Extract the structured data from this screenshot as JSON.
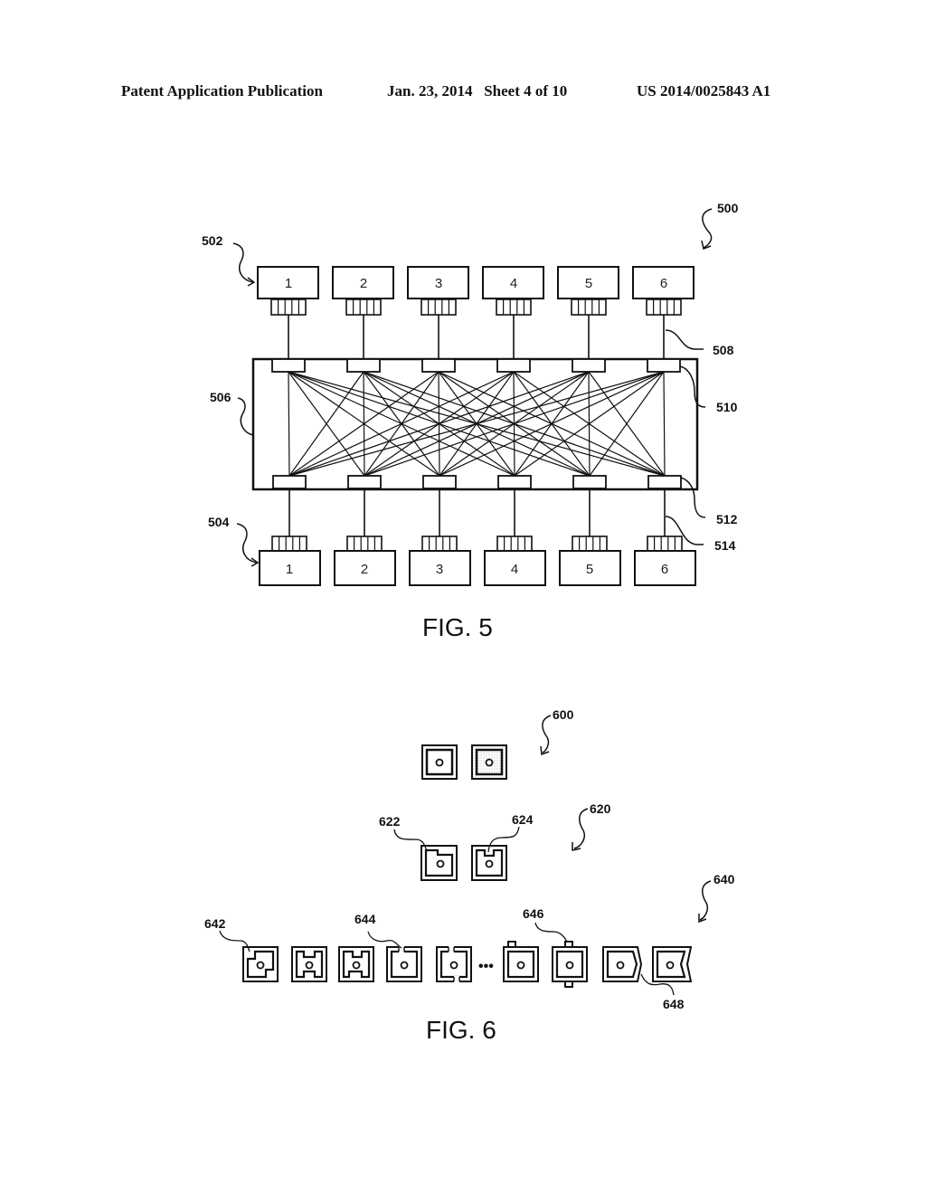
{
  "header": {
    "publication": "Patent Application Publication",
    "date_sheet": "Jan. 23, 2014   Sheet 4 of 10",
    "patent_number": "US 2014/0025843 A1"
  },
  "fig5": {
    "caption": "FIG. 5",
    "top_boxes": [
      "1",
      "2",
      "3",
      "4",
      "5",
      "6"
    ],
    "bottom_boxes": [
      "1",
      "2",
      "3",
      "4",
      "5",
      "6"
    ],
    "refs": {
      "r500": "500",
      "r502": "502",
      "r504": "504",
      "r506": "506",
      "r508": "508",
      "r510": "510",
      "r512": "512",
      "r514": "514"
    },
    "connection_pattern": "full-mesh: every top port connects to every bottom port"
  },
  "fig6": {
    "caption": "FIG. 6",
    "refs": {
      "r600": "600",
      "r620": "620",
      "r622": "622",
      "r624": "624",
      "r640": "640",
      "r642": "642",
      "r644": "644",
      "r646": "646",
      "r648": "648"
    },
    "ellipsis": "•••"
  }
}
